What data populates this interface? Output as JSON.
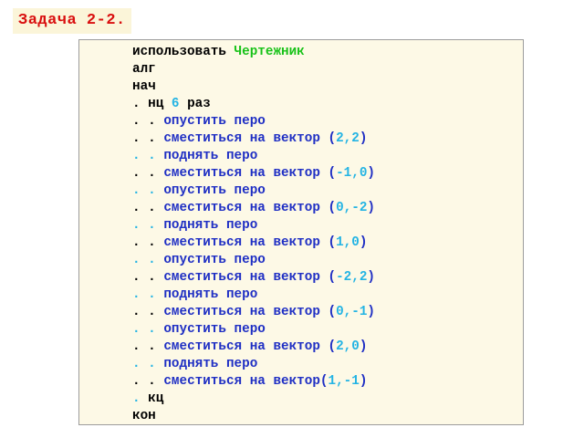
{
  "title": "Задача 2-2.",
  "colors": {
    "title_text": "#d90f0f",
    "title_bg": "#fbf5d9",
    "box_bg": "#fdf9e6",
    "keyword": "#000000",
    "executor": "#18c218",
    "number": "#24b4e4",
    "command": "#1f2fc4"
  },
  "code_lines": [
    [
      {
        "t": "использовать ",
        "c": "k"
      },
      {
        "t": "Чертежник",
        "c": "g"
      }
    ],
    [
      {
        "t": "алг",
        "c": "k"
      }
    ],
    [
      {
        "t": "нач",
        "c": "k"
      }
    ],
    [
      {
        "t": ". нц ",
        "c": "k"
      },
      {
        "t": "6",
        "c": "c"
      },
      {
        "t": " раз",
        "c": "k"
      }
    ],
    [
      {
        "t": ". . ",
        "c": "k"
      },
      {
        "t": "опустить перо",
        "c": "b"
      }
    ],
    [
      {
        "t": ". . ",
        "c": "k"
      },
      {
        "t": "сместиться на вектор (",
        "c": "b"
      },
      {
        "t": "2,2",
        "c": "c"
      },
      {
        "t": ")",
        "c": "b"
      }
    ],
    [
      {
        "t": ". . ",
        "c": "c"
      },
      {
        "t": "поднять перо",
        "c": "b"
      }
    ],
    [
      {
        "t": ". . ",
        "c": "k"
      },
      {
        "t": "сместиться на вектор (",
        "c": "b"
      },
      {
        "t": "-1,0",
        "c": "c"
      },
      {
        "t": ")",
        "c": "b"
      }
    ],
    [
      {
        "t": ". . ",
        "c": "c"
      },
      {
        "t": "опустить перо",
        "c": "b"
      }
    ],
    [
      {
        "t": ". . ",
        "c": "k"
      },
      {
        "t": "сместиться на вектор (",
        "c": "b"
      },
      {
        "t": "0,-2",
        "c": "c"
      },
      {
        "t": ")",
        "c": "b"
      }
    ],
    [
      {
        "t": ". . ",
        "c": "c"
      },
      {
        "t": "поднять перо",
        "c": "b"
      }
    ],
    [
      {
        "t": ". . ",
        "c": "k"
      },
      {
        "t": "сместиться на вектор (",
        "c": "b"
      },
      {
        "t": "1,0",
        "c": "c"
      },
      {
        "t": ")",
        "c": "b"
      }
    ],
    [
      {
        "t": ". . ",
        "c": "c"
      },
      {
        "t": "опустить перо",
        "c": "b"
      }
    ],
    [
      {
        "t": ". . ",
        "c": "k"
      },
      {
        "t": "сместиться на вектор (",
        "c": "b"
      },
      {
        "t": "-2,2",
        "c": "c"
      },
      {
        "t": ")",
        "c": "b"
      }
    ],
    [
      {
        "t": ". . ",
        "c": "c"
      },
      {
        "t": "поднять перо",
        "c": "b"
      }
    ],
    [
      {
        "t": ". . ",
        "c": "k"
      },
      {
        "t": "сместиться на вектор (",
        "c": "b"
      },
      {
        "t": "0,-1",
        "c": "c"
      },
      {
        "t": ")",
        "c": "b"
      }
    ],
    [
      {
        "t": ". . ",
        "c": "c"
      },
      {
        "t": "опустить перо",
        "c": "b"
      }
    ],
    [
      {
        "t": ". . ",
        "c": "k"
      },
      {
        "t": "сместиться на вектор (",
        "c": "b"
      },
      {
        "t": "2,0",
        "c": "c"
      },
      {
        "t": ")",
        "c": "b"
      }
    ],
    [
      {
        "t": ". . ",
        "c": "c"
      },
      {
        "t": "поднять перо",
        "c": "b"
      }
    ],
    [
      {
        "t": ". . ",
        "c": "k"
      },
      {
        "t": "сместиться на вектор(",
        "c": "b"
      },
      {
        "t": "1,-1",
        "c": "c"
      },
      {
        "t": ")",
        "c": "b"
      }
    ],
    [
      {
        "t": ". ",
        "c": "c"
      },
      {
        "t": "кц",
        "c": "k"
      }
    ],
    [
      {
        "t": "кон",
        "c": "k"
      }
    ]
  ]
}
